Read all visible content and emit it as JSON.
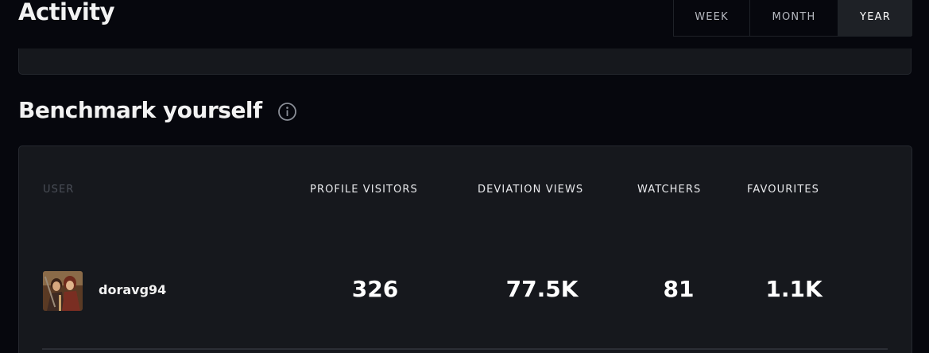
{
  "activity": {
    "title": "Activity",
    "tabs": [
      {
        "label": "WEEK",
        "selected": false
      },
      {
        "label": "MONTH",
        "selected": false
      },
      {
        "label": "YEAR",
        "selected": true
      }
    ]
  },
  "benchmark": {
    "title": "Benchmark yourself",
    "columns": {
      "user": "USER",
      "profile_visitors": "PROFILE VISITORS",
      "deviation_views": "DEVIATION VIEWS",
      "watchers": "WATCHERS",
      "favourites": "FAVOURITES"
    },
    "rows": [
      {
        "username": "doravg94",
        "profile_visitors": "326",
        "deviation_views": "77.5K",
        "watchers": "81",
        "favourites": "1.1K"
      }
    ]
  },
  "colors": {
    "background": "#06070d",
    "card": "#16181d",
    "selected_tab": "#1e2126",
    "muted_text": "#4a4e57"
  },
  "icons": {
    "info": "info-icon",
    "avatar": "avatar"
  }
}
